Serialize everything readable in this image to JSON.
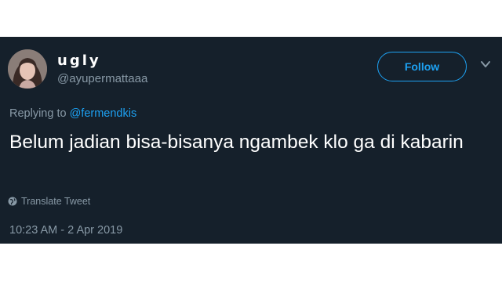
{
  "tweet": {
    "display_name": "ugly",
    "handle": "@ayupermattaaa",
    "follow_label": "Follow",
    "replying_prefix": "Replying to ",
    "replying_to": "@fermendkis",
    "text": "Belum jadian bisa-bisanya ngambek klo ga di kabarin",
    "translate_label": "Translate Tweet",
    "timestamp": "10:23 AM - 2 Apr 2019"
  },
  "icons": {
    "more": "chevron-down-icon",
    "translate": "globe-icon"
  },
  "colors": {
    "background": "#15202b",
    "accent": "#1da1f2",
    "secondary_text": "#8899a6",
    "primary_text": "#ffffff"
  }
}
